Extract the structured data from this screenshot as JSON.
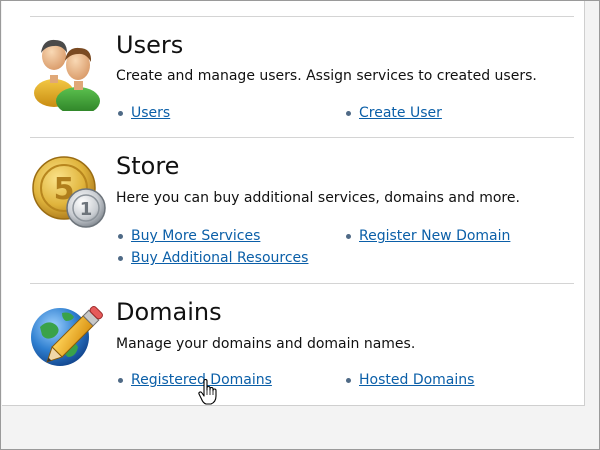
{
  "sections": [
    {
      "title": "Users",
      "description": "Create and manage users. Assign services to created users.",
      "links": [
        {
          "label": "Users"
        },
        {
          "label": "Create User"
        }
      ],
      "icon": "users-icon"
    },
    {
      "title": "Store",
      "description": "Here you can buy additional services, domains and more.",
      "links": [
        {
          "label": "Buy More Services"
        },
        {
          "label": "Register New Domain"
        },
        {
          "label": "Buy Additional Resources"
        }
      ],
      "icon": "coins-icon"
    },
    {
      "title": "Domains",
      "description": "Manage your domains and domain names.",
      "links": [
        {
          "label": "Registered Domains"
        },
        {
          "label": "Hosted Domains"
        }
      ],
      "icon": "globe-pencil-icon"
    }
  ],
  "colors": {
    "link": "#0b5fa8",
    "bullet": "#4f6a86",
    "divider": "#d4d4d4",
    "text": "#111111"
  },
  "cursor": "hand-pointer-icon"
}
